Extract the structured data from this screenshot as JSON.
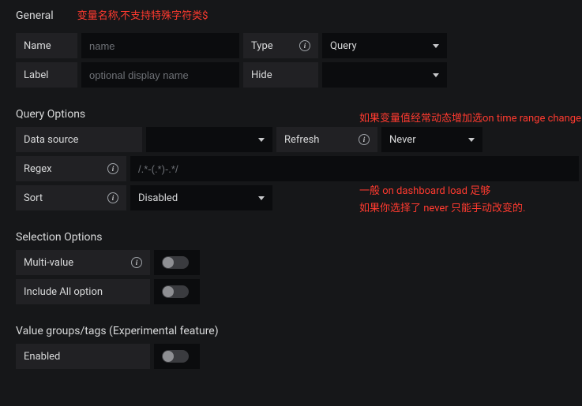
{
  "general": {
    "title": "General",
    "note_red": "变量名称,不支持特殊字符类$",
    "name_label": "Name",
    "name_placeholder": "name",
    "label_label": "Label",
    "label_placeholder": "optional display name",
    "type_label": "Type",
    "type_value": "Query",
    "hide_label": "Hide",
    "hide_value": ""
  },
  "query_options": {
    "title": "Query Options",
    "note_red_1": "如果变量值经常动态增加选on time range change",
    "note_red_2": "一般 on dashboard load 足够",
    "note_red_3": "如果你选择了 never 只能手动改变的.",
    "data_source_label": "Data source",
    "data_source_value": "",
    "refresh_label": "Refresh",
    "refresh_value": "Never",
    "regex_label": "Regex",
    "regex_placeholder": "/.*-(.*)-.*/",
    "sort_label": "Sort",
    "sort_value": "Disabled"
  },
  "selection_options": {
    "title": "Selection Options",
    "multi_value_label": "Multi-value",
    "include_all_label": "Include All option"
  },
  "value_groups": {
    "title": "Value groups/tags (Experimental feature)",
    "enabled_label": "Enabled"
  }
}
